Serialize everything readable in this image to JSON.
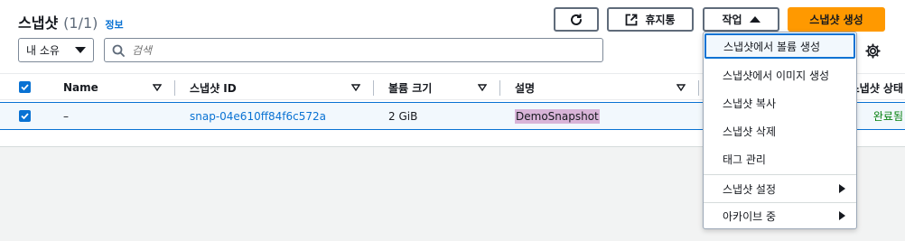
{
  "header": {
    "title": "스냅샷",
    "count": "(1/1)",
    "info_link": "정보",
    "recycle_label": "휴지통",
    "actions_label": "작업",
    "create_label": "스냅샷 생성"
  },
  "filters": {
    "owner_select": "내 소유",
    "search_placeholder": "검색"
  },
  "table": {
    "columns": [
      {
        "label": "Name"
      },
      {
        "label": "스냅샷 ID"
      },
      {
        "label": "볼륨 크기"
      },
      {
        "label": "설명"
      },
      {
        "label": "스냅샷 상태"
      }
    ],
    "rows": [
      {
        "name": "–",
        "snapshot_id": "snap-04e610ff84f6c572a",
        "volume_size": "2 GiB",
        "description": "DemoSnapshot",
        "status": "완료됨"
      }
    ]
  },
  "actions_menu": {
    "items": [
      {
        "label": "스냅샷에서 볼륨 생성"
      },
      {
        "label": "스냅샷에서 이미지 생성"
      },
      {
        "label": "스냅샷 복사"
      },
      {
        "label": "스냅샷 삭제"
      },
      {
        "label": "태그 관리"
      },
      {
        "label": "스냅샷 설정"
      },
      {
        "label": "아카이브 중"
      }
    ]
  },
  "colors": {
    "accent": "#0972d3",
    "primary_button": "#ff9900",
    "status_success": "#037f0c",
    "description_highlight": "#d8b4d8"
  },
  "icons": [
    "refresh-icon",
    "external-link-icon",
    "search-icon",
    "gear-icon",
    "sort-icon",
    "checkbox-checked-icon",
    "submenu-arrow-icon"
  ]
}
